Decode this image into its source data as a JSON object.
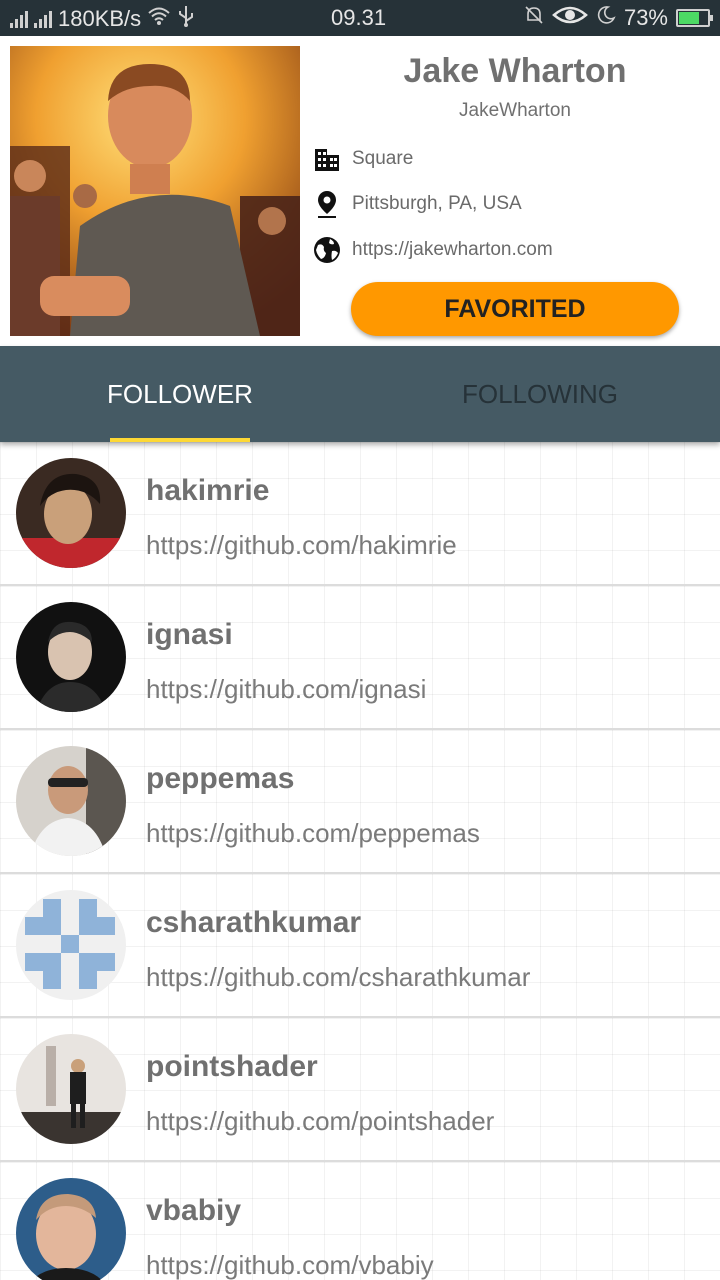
{
  "status_bar": {
    "speed": "180KB/s",
    "time": "09.31",
    "battery_percent": "73%",
    "battery_level": 0.73,
    "icons": [
      "signal-icon",
      "signal-icon",
      "wifi-icon",
      "usb-icon",
      "mute-icon",
      "eye-icon",
      "moon-icon",
      "battery-icon"
    ]
  },
  "profile": {
    "name": "Jake Wharton",
    "username": "JakeWharton",
    "company": "Square",
    "location": "Pittsburgh, PA, USA",
    "blog": "https://jakewharton.com",
    "favorite_label": "FAVORITED",
    "accent_color": "#ff9800"
  },
  "tabs": {
    "follower": "FOLLOWER",
    "following": "FOLLOWING",
    "indicator_color": "#fdd835",
    "bar_color": "#455a64"
  },
  "followers": [
    {
      "login": "hakimrie",
      "url": "https://github.com/hakimrie"
    },
    {
      "login": "ignasi",
      "url": "https://github.com/ignasi"
    },
    {
      "login": "peppemas",
      "url": "https://github.com/peppemas"
    },
    {
      "login": "csharathkumar",
      "url": "https://github.com/csharathkumar"
    },
    {
      "login": "pointshader",
      "url": "https://github.com/pointshader"
    },
    {
      "login": "vbabiy",
      "url": "https://github.com/vbabiy"
    }
  ]
}
